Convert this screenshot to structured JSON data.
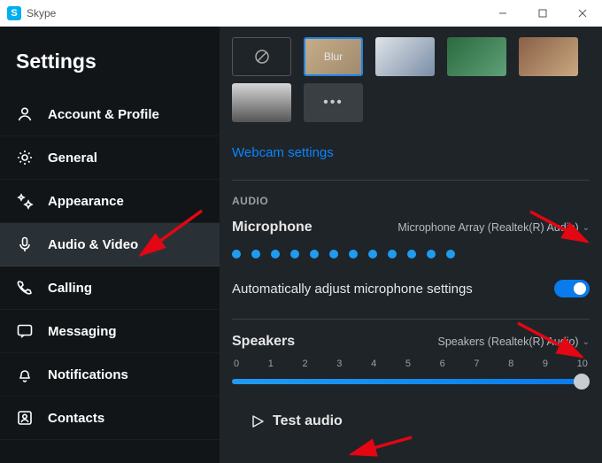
{
  "window": {
    "app_name": "Skype",
    "logo_letter": "S"
  },
  "sidebar": {
    "title": "Settings",
    "items": [
      {
        "label": "Account & Profile",
        "icon": "person-icon"
      },
      {
        "label": "General",
        "icon": "gear-icon"
      },
      {
        "label": "Appearance",
        "icon": "sparkle-icon"
      },
      {
        "label": "Audio & Video",
        "icon": "mic-icon",
        "active": true
      },
      {
        "label": "Calling",
        "icon": "phone-icon"
      },
      {
        "label": "Messaging",
        "icon": "chat-icon"
      },
      {
        "label": "Notifications",
        "icon": "bell-icon"
      },
      {
        "label": "Contacts",
        "icon": "contacts-icon"
      }
    ]
  },
  "backgrounds": {
    "blur_label": "Blur",
    "more_label": "•••"
  },
  "webcam_link": "Webcam settings",
  "audio": {
    "section_label": "AUDIO",
    "microphone_label": "Microphone",
    "microphone_device": "Microphone Array (Realtek(R) Audio)",
    "auto_adjust_label": "Automatically adjust microphone settings",
    "auto_adjust_on": true,
    "speakers_label": "Speakers",
    "speakers_device": "Speakers (Realtek(R) Audio)",
    "speaker_ticks": [
      "0",
      "1",
      "2",
      "3",
      "4",
      "5",
      "6",
      "7",
      "8",
      "9",
      "10"
    ],
    "speaker_value": 10,
    "test_audio_label": "Test audio"
  }
}
